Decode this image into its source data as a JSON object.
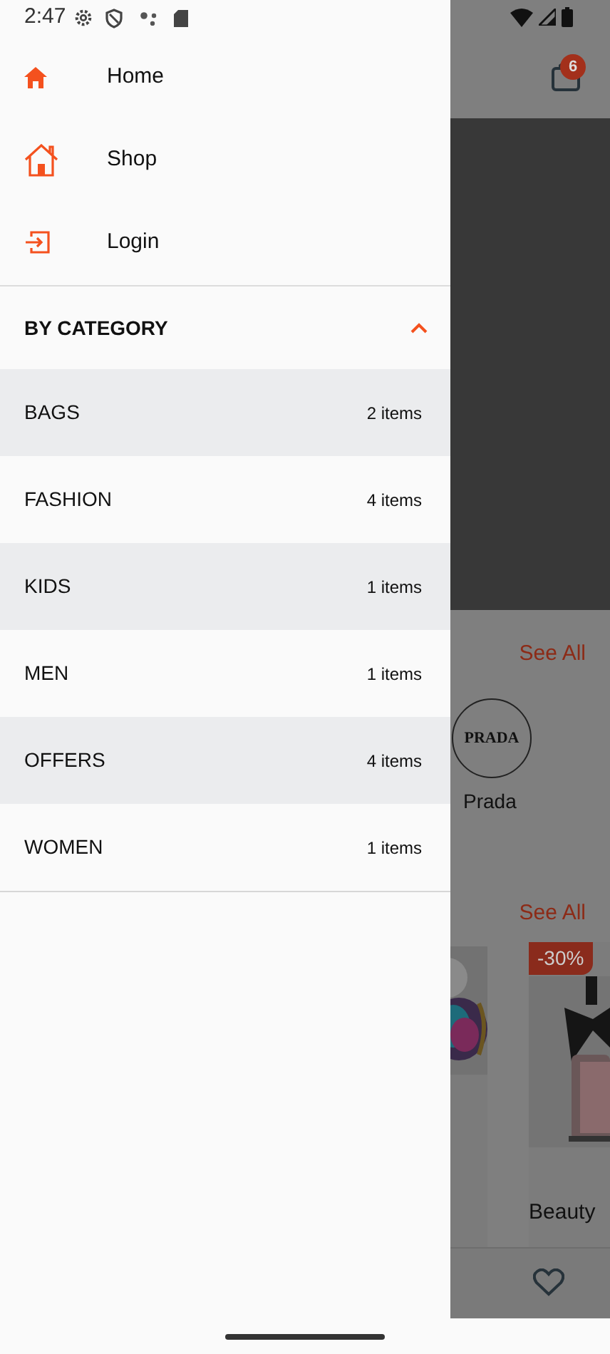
{
  "status_bar": {
    "time": "2:47"
  },
  "drawer": {
    "menu": [
      {
        "kind": "home",
        "label": "Home"
      },
      {
        "kind": "shop",
        "label": "Shop"
      },
      {
        "kind": "login",
        "label": "Login"
      }
    ],
    "category_header": {
      "label": "BY CATEGORY",
      "expanded": true
    },
    "categories": [
      {
        "name": "BAGS",
        "count": "2 items"
      },
      {
        "name": "FASHION",
        "count": "4 items"
      },
      {
        "name": "KIDS",
        "count": "1 items"
      },
      {
        "name": "MEN",
        "count": "1 items"
      },
      {
        "name": "OFFERS",
        "count": "4 items"
      },
      {
        "name": "WOMEN",
        "count": "1 items"
      }
    ]
  },
  "background_screen": {
    "cart_badge": "6",
    "brands_see_all": "See All",
    "brand": {
      "logo": "PRADA",
      "name": "Prada"
    },
    "products_see_all": "See All",
    "product": {
      "discount": "-30%",
      "category": "Beauty"
    }
  }
}
